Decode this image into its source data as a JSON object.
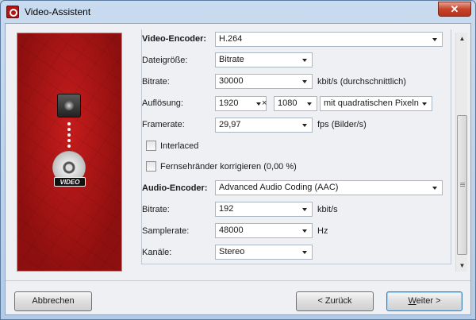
{
  "window": {
    "title": "Video-Assistent",
    "close_glyph": "✕"
  },
  "video": {
    "encoder_label": "Video-Encoder:",
    "encoder_value": "H.264",
    "filesize_label": "Dateigröße:",
    "filesize_value": "Bitrate",
    "bitrate_label": "Bitrate:",
    "bitrate_value": "30000",
    "bitrate_unit": "kbit/s (durchschnittlich)",
    "resolution_label": "Auflösung:",
    "res_width": "1920",
    "res_times": "×",
    "res_height": "1080",
    "pixel_aspect": "mit quadratischen Pixeln",
    "framerate_label": "Framerate:",
    "framerate_value": "29,97",
    "framerate_unit": "fps (Bilder/s)",
    "interlaced_label": "Interlaced",
    "interlaced_checked": false,
    "tv_border_label": "Fernsehränder korrigieren (0,00 %)",
    "tv_border_checked": false
  },
  "audio": {
    "encoder_label": "Audio-Encoder:",
    "encoder_value": "Advanced Audio Coding (AAC)",
    "bitrate_label": "Bitrate:",
    "bitrate_value": "192",
    "bitrate_unit": "kbit/s",
    "samplerate_label": "Samplerate:",
    "samplerate_value": "48000",
    "samplerate_unit": "Hz",
    "channels_label": "Kanäle:",
    "channels_value": "Stereo"
  },
  "sidepanel": {
    "badge_text": "VIDEO"
  },
  "buttons": {
    "cancel": "Abbrechen",
    "back": "< Zurück",
    "next_mnemonic": "W",
    "next_rest": "eiter >"
  },
  "scrollbar": {
    "up_glyph": "▲",
    "down_glyph": "▼"
  }
}
